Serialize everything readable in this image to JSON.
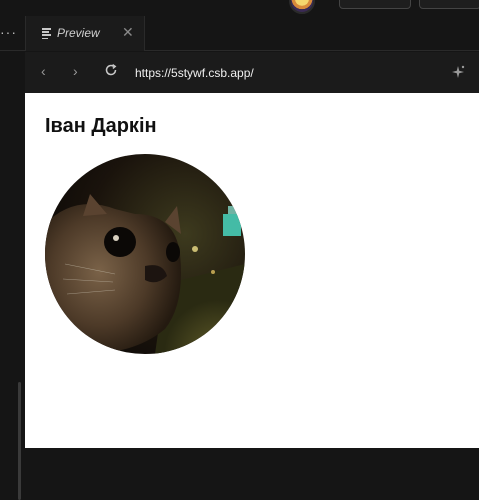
{
  "tab": {
    "label": "Preview"
  },
  "address": {
    "url": "https://5stywf.csb.app/"
  },
  "page": {
    "title": "Іван Даркін"
  },
  "colors": {
    "chrome_bg": "#151515",
    "tab_bg": "#1b1b1b",
    "viewport_bg": "#ffffff"
  },
  "icons": [
    "more-icon",
    "preview-icon",
    "close-icon",
    "back-icon",
    "forward-icon",
    "reload-icon",
    "sparkle-icon"
  ]
}
